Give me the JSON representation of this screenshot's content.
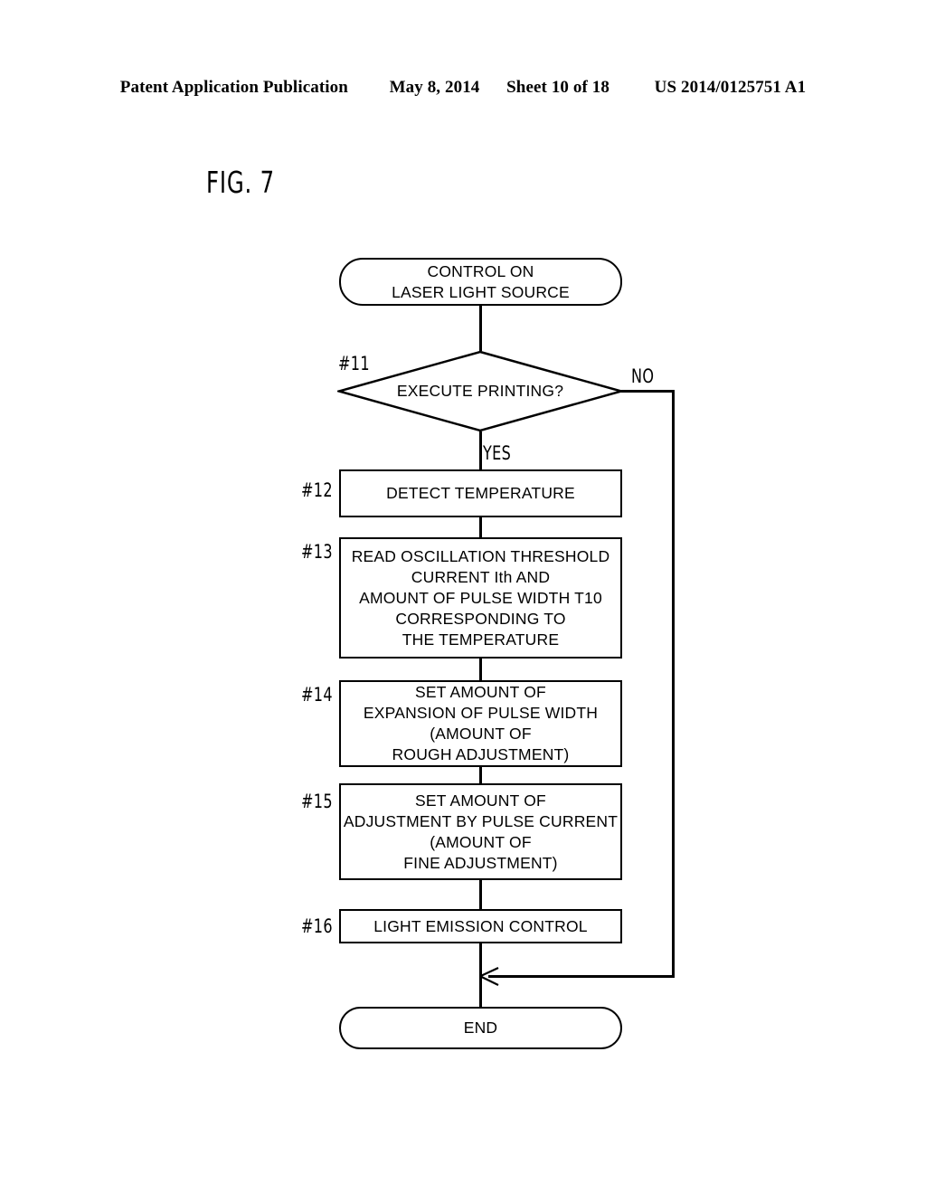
{
  "header": {
    "publication": "Patent Application Publication",
    "date": "May 8, 2014",
    "sheet": "Sheet 10 of 18",
    "patent_number": "US 2014/0125751 A1"
  },
  "figure": {
    "label": "FIG. 7"
  },
  "flowchart": {
    "start": {
      "ref": "",
      "lines": [
        "CONTROL ON",
        "LASER LIGHT SOURCE"
      ]
    },
    "decision": {
      "ref": "#11",
      "text": "EXECUTE PRINTING?",
      "yes_label": "YES",
      "no_label": "NO"
    },
    "steps": [
      {
        "ref": "#12",
        "lines": [
          "DETECT TEMPERATURE"
        ]
      },
      {
        "ref": "#13",
        "lines": [
          "READ OSCILLATION THRESHOLD",
          "CURRENT Ith AND",
          "AMOUNT OF PULSE WIDTH T10",
          "CORRESPONDING TO",
          "THE TEMPERATURE"
        ]
      },
      {
        "ref": "#14",
        "lines": [
          "SET AMOUNT OF",
          "EXPANSION OF PULSE WIDTH",
          "(AMOUNT OF",
          "ROUGH ADJUSTMENT)"
        ]
      },
      {
        "ref": "#15",
        "lines": [
          "SET AMOUNT OF",
          "ADJUSTMENT BY PULSE CURRENT",
          "(AMOUNT OF",
          "FINE ADJUSTMENT)"
        ]
      },
      {
        "ref": "#16",
        "lines": [
          "LIGHT EMISSION CONTROL"
        ]
      }
    ],
    "end": {
      "lines": [
        "END"
      ]
    }
  },
  "colors": {
    "ink": "#000000",
    "paper": "#ffffff"
  }
}
